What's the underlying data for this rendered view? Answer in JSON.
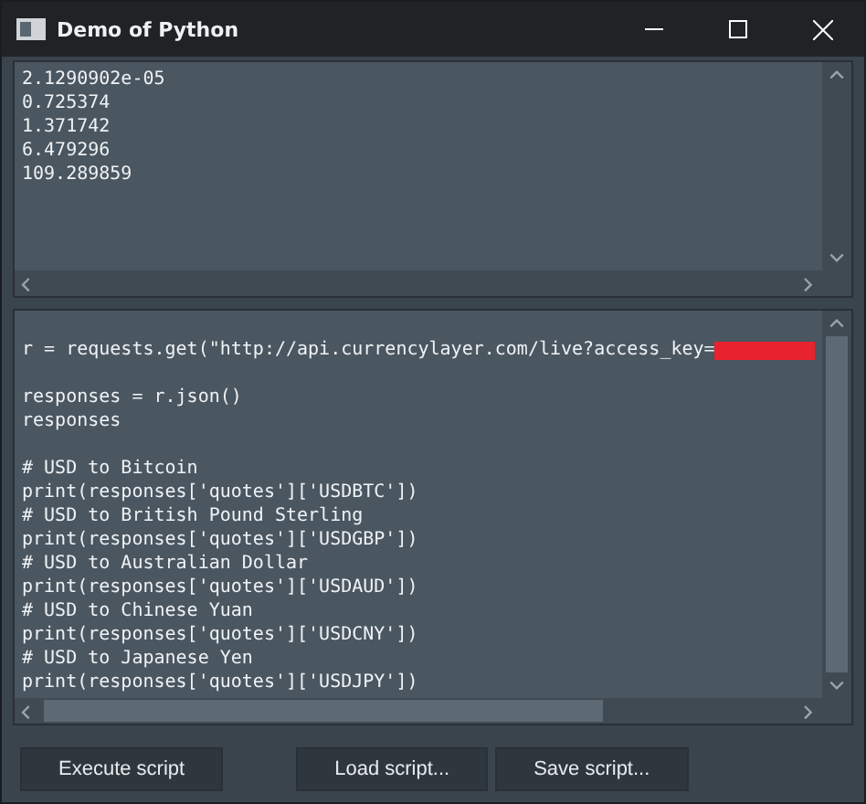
{
  "window": {
    "title": "Demo of Python"
  },
  "output": {
    "lines": [
      "2.1290902e-05",
      "0.725374",
      "1.371742",
      "6.479296",
      "109.289859"
    ]
  },
  "code": {
    "blocks": [
      [
        "r = requests.get(\"http://api.currencylayer.com/live?access_key="
      ],
      [
        "responses = r.json()",
        "responses"
      ],
      [
        "# USD to Bitcoin",
        "print(responses['quotes']['USDBTC'])",
        "# USD to British Pound Sterling",
        "print(responses['quotes']['USDGBP'])",
        "# USD to Australian Dollar",
        "print(responses['quotes']['USDAUD'])",
        "# USD to Chinese Yuan",
        "print(responses['quotes']['USDCNY'])",
        "# USD to Japanese Yen",
        "print(responses['quotes']['USDJPY'])"
      ]
    ]
  },
  "buttons": [
    "Execute script",
    "Load script...",
    "Save script..."
  ]
}
